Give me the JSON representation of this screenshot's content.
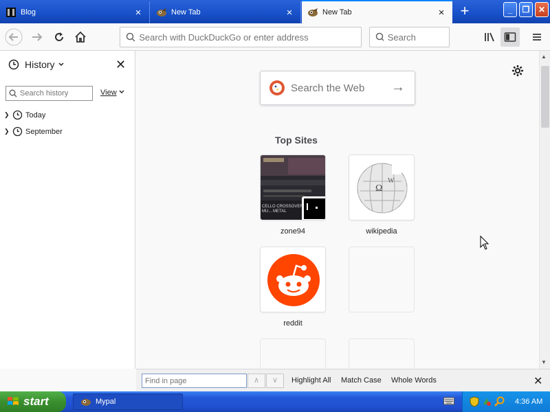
{
  "tabs": [
    {
      "label": "Blog",
      "active": false
    },
    {
      "label": "New Tab",
      "active": false
    },
    {
      "label": "New Tab",
      "active": true
    }
  ],
  "tab_close_glyph": "×",
  "new_tab_glyph": "+",
  "window_controls": {
    "minimize": "_",
    "maximize": "❐",
    "close": "✕"
  },
  "navbar": {
    "url_placeholder": "Search with DuckDuckGo or enter address",
    "search_placeholder": "Search"
  },
  "sidebar": {
    "title": "History",
    "search_placeholder": "Search history",
    "view_label": "View",
    "items": [
      {
        "label": "Today"
      },
      {
        "label": "September"
      }
    ]
  },
  "newtab": {
    "search_placeholder": "Search the Web",
    "top_sites_title": "Top Sites",
    "sites": [
      {
        "label": "zone94"
      },
      {
        "label": "wikipedia"
      },
      {
        "label": "reddit"
      },
      {
        "label": ""
      }
    ],
    "zone94_thumb_text": "CELLO CROSSOVER MU... METAL"
  },
  "findbar": {
    "placeholder": "Find in page",
    "highlight_all": "Highlight All",
    "match_case": "Match Case",
    "whole_words": "Whole Words",
    "close_glyph": "✕"
  },
  "taskbar": {
    "start_label": "start",
    "task_label": "Mypal",
    "clock": "4:36 AM"
  },
  "colors": {
    "xp_blue": "#1750c8",
    "reddit": "#ff4500",
    "duckduckgo": "#de5833",
    "start_green": "#3a8f2f"
  }
}
